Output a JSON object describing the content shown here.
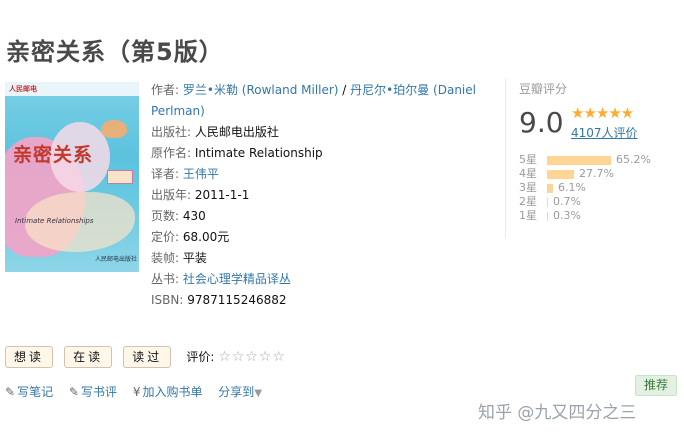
{
  "book": {
    "title": "亲密关系（第5版）"
  },
  "cover": {
    "logo_text": "人民邮电",
    "title_text": "亲密关系",
    "script_text": "Intimate Relationships",
    "publisher_text": "人民邮电出版社"
  },
  "info": {
    "author_label": "作者:",
    "author1": "罗兰•米勒 (Rowland Miller)",
    "sep": " / ",
    "author2a": "丹尼尔•珀尔曼 (Daniel",
    "author2b": "Perlman)",
    "publisher_label": "出版社:",
    "publisher": "人民邮电出版社",
    "orig_label": "原作名:",
    "orig": "Intimate Relationship",
    "translator_label": "译者:",
    "translator": "王伟平",
    "year_label": "出版年:",
    "year": "2011-1-1",
    "pages_label": "页数:",
    "pages": "430",
    "price_label": "定价:",
    "price": "68.00元",
    "binding_label": "装帧:",
    "binding": "平装",
    "series_label": "丛书:",
    "series": "社会心理学精品译丛",
    "isbn_label": "ISBN:",
    "isbn": "9787115246882"
  },
  "rating": {
    "heading": "豆瓣评分",
    "score": "9.0",
    "stars": "★★★★★",
    "votes": "4107人评价",
    "dist": [
      {
        "label": "5星",
        "pct": "65.2%",
        "value": 65.2
      },
      {
        "label": "4星",
        "pct": "27.7%",
        "value": 27.7
      },
      {
        "label": "3星",
        "pct": "6.1%",
        "value": 6.1
      },
      {
        "label": "2星",
        "pct": "0.7%",
        "value": 0.7
      },
      {
        "label": "1星",
        "pct": "0.3%",
        "value": 0.3
      }
    ]
  },
  "buttons": {
    "want": "想读",
    "reading": "在读",
    "read": "读过",
    "rate_label": "评价:",
    "rate_stars": "☆☆☆☆☆"
  },
  "actions": {
    "note": "写笔记",
    "review": "写书评",
    "cart": "加入购书单",
    "share": "分享到"
  },
  "recommend": "推荐",
  "watermark": "知乎 @九又四分之三"
}
